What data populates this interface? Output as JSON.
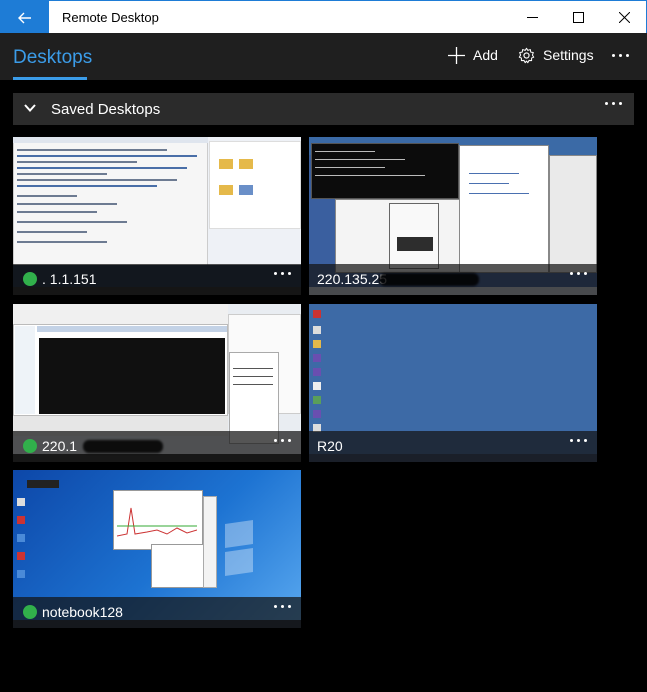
{
  "window": {
    "title": "Remote Desktop",
    "accent": "#1e7cd6"
  },
  "header": {
    "tab_label": "Desktops",
    "add_label": "Add",
    "settings_label": "Settings"
  },
  "group": {
    "title": "Saved Desktops"
  },
  "desktops": [
    {
      "name": ". 1.1.151",
      "status": "connected",
      "status_color": "#31b04b"
    },
    {
      "name": "220.135.25",
      "status": "none"
    },
    {
      "name": "220.1",
      "status": "connected",
      "status_color": "#31b04b"
    },
    {
      "name": "R20",
      "status": "none"
    },
    {
      "name": "notebook128",
      "status": "connected",
      "status_color": "#31b04b"
    }
  ],
  "icons": {
    "back": "back-arrow-icon",
    "minimize": "minimize-icon",
    "maximize": "maximize-icon",
    "close": "close-icon",
    "add": "plus-icon",
    "settings": "gear-icon",
    "more": "more-icon",
    "collapse": "chevron-down-icon"
  }
}
